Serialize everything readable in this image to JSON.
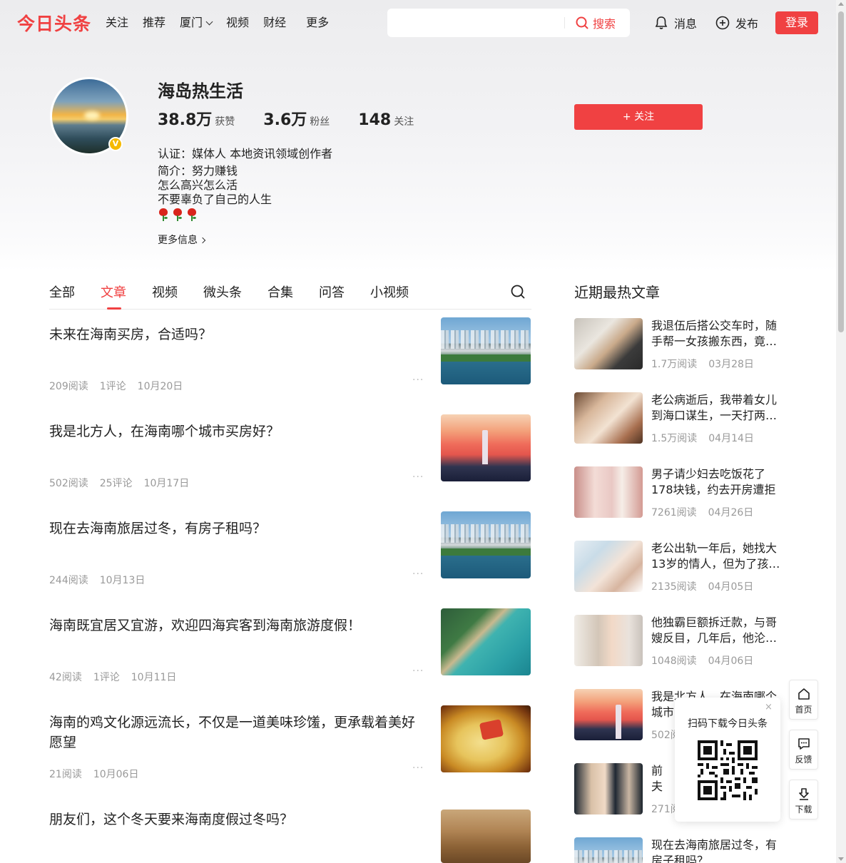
{
  "header": {
    "logo": "今日头条",
    "nav": [
      {
        "label": "关注"
      },
      {
        "label": "推荐"
      },
      {
        "label": "厦门"
      },
      {
        "label": "视频"
      },
      {
        "label": "财经"
      },
      {
        "label": "更多"
      }
    ],
    "search": {
      "placeholder": "",
      "button": "搜索"
    },
    "messages": "消息",
    "publish": "发布",
    "login": "登录"
  },
  "profile": {
    "name": "海岛热生活",
    "stats": [
      {
        "num": "38.8万",
        "label": "获赞"
      },
      {
        "num": "3.6万",
        "label": "粉丝"
      },
      {
        "num": "148",
        "label": "关注"
      }
    ],
    "follow_button": "+ 关注",
    "certification": "认证：媒体人 本地资讯领域创作者",
    "bio_lines": [
      "简介：努力赚钱",
      "怎么高兴怎么活",
      "不要辜负了自己的人生"
    ],
    "more_info": "更多信息",
    "verified_badge": "V"
  },
  "tabs": [
    "全部",
    "文章",
    "视频",
    "微头条",
    "合集",
    "问答",
    "小视频"
  ],
  "active_tab": "文章",
  "articles": [
    {
      "title": "未来在海南买房，合适吗？",
      "reads": "209阅读",
      "comments": "1评论",
      "date": "10月20日",
      "thumb": "th-city"
    },
    {
      "title": "我是北方人，在海南哪个城市买房好？",
      "reads": "502阅读",
      "comments": "25评论",
      "date": "10月17日",
      "thumb": "th-sunset"
    },
    {
      "title": "现在去海南旅居过冬，有房子租吗？",
      "reads": "244阅读",
      "comments": "",
      "date": "10月13日",
      "thumb": "th-city"
    },
    {
      "title": "海南既宜居又宜游，欢迎四海宾客到海南旅游度假！",
      "reads": "42阅读",
      "comments": "1评论",
      "date": "10月11日",
      "thumb": "th-coast"
    },
    {
      "title": "海南的鸡文化源远流长，不仅是一道美味珍馐，更承载着美好愿望",
      "reads": "21阅读",
      "comments": "",
      "date": "10月06日",
      "thumb": "th-chicken"
    },
    {
      "title": "朋友们，这个冬天要来海南度假过冬吗？",
      "reads": "",
      "comments": "",
      "date": "",
      "thumb": "th-beach"
    }
  ],
  "sidebar": {
    "title": "近期最热文章",
    "items": [
      {
        "title": "我退伍后搭公交车时，随手帮一女孩搬东西，竟…",
        "reads": "1.7万阅读",
        "date": "03月28日",
        "thumb": "th-office"
      },
      {
        "title": "老公病逝后，我带着女儿到海口谋生，一天打两…",
        "reads": "1.5万阅读",
        "date": "04月14日",
        "thumb": "th-mom"
      },
      {
        "title": "男子请少妇去吃饭花了178块钱，约去开房遭拒后…",
        "reads": "7261阅读",
        "date": "04月26日",
        "thumb": "th-girls"
      },
      {
        "title": "老公出轨一年后，她找大13岁的情人，但为了孩…",
        "reads": "2135阅读",
        "date": "04月05日",
        "thumb": "th-bed"
      },
      {
        "title": "他独霸巨额拆迁款，与哥嫂反目，几年后，他沦…",
        "reads": "1048阅读",
        "date": "04月06日",
        "thumb": "th-cry"
      },
      {
        "title": "我是北方人，在海南哪个城市买房好？",
        "reads": "502阅读",
        "date": "",
        "thumb": "th-sunset"
      },
      {
        "title": "前夫后跑",
        "reads": "271阅读",
        "date": "",
        "thumb": "th-suits"
      },
      {
        "title": "现在去海南旅居过冬，有房子租吗？",
        "reads": "",
        "date": "",
        "thumb": "th-city"
      }
    ]
  },
  "floating": {
    "home": "首页",
    "feedback": "反馈",
    "download": "下载",
    "qr_title": "扫码下载今日头条",
    "qr_close": "×"
  },
  "colors": {
    "accent": "#f04142",
    "badge": "#f5b900"
  }
}
